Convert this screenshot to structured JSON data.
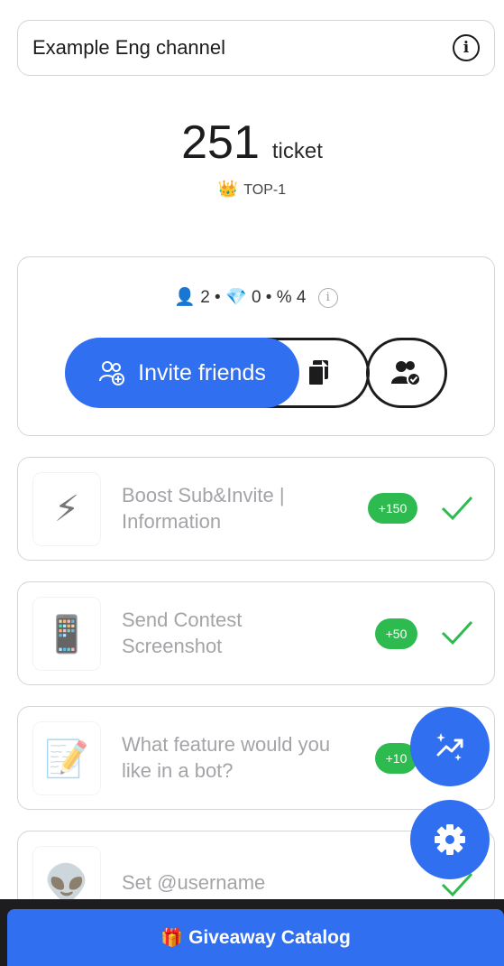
{
  "channel": {
    "name": "Example Eng channel",
    "info_icon": "info-icon"
  },
  "tickets": {
    "count": "251",
    "unit": "ticket"
  },
  "rank": {
    "icon": "👑",
    "label": "TOP-1"
  },
  "stats": {
    "user_icon": "👤",
    "users": "2",
    "gem_icon": "💎",
    "gems": "0",
    "percent": "% 4",
    "sep": "•"
  },
  "invite": {
    "label": "Invite friends"
  },
  "tasks": [
    {
      "emoji": "⚡",
      "title": "Boost Sub&Invite | Information",
      "reward": "+150",
      "done": true
    },
    {
      "emoji": "📱",
      "title": "Send Contest Screenshot",
      "reward": "+50",
      "done": true
    },
    {
      "emoji": "📝",
      "title": "What feature would you like in a bot?",
      "reward": "+10",
      "done": false
    },
    {
      "emoji": "👽",
      "title": "Set @username",
      "reward": "",
      "done": true
    }
  ],
  "catalog": {
    "icon": "🎁",
    "label": "Giveaway Catalog"
  },
  "colors": {
    "accent": "#2f6ff0",
    "success": "#2dbb4f",
    "muted_text": "#a4a4a8"
  }
}
